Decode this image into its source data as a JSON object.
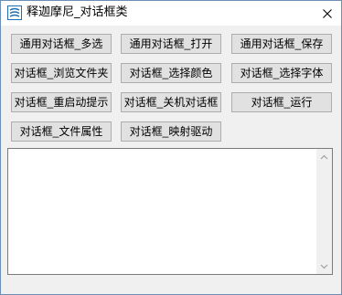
{
  "window": {
    "title": "释迦摩尼_对话框类",
    "app_icon": "app-logo-icon",
    "close_icon": "close-icon"
  },
  "buttons": {
    "row1": [
      "通用对话框_多选",
      "通用对话框_打开",
      "通用对话框_保存"
    ],
    "row2": [
      "对话框_浏览文件夹",
      "对话框_选择颜色",
      "对话框_选择字体"
    ],
    "row3": [
      "对话框_重启动提示",
      "对话框_关机对话框",
      "对话框_运行"
    ],
    "row4": [
      "对话框_文件属性",
      "对话框_映射驱动"
    ]
  },
  "editor": {
    "value": "",
    "scroll_up_icon": "scroll-up-arrow-icon",
    "scroll_down_icon": "scroll-down-arrow-icon"
  },
  "colors": {
    "window_border": "#6e8fb5",
    "client_bg": "#f0f0f0",
    "button_bg": "#e1e1e1",
    "button_border": "#adadad",
    "icon_accent": "#1f6fb2"
  }
}
